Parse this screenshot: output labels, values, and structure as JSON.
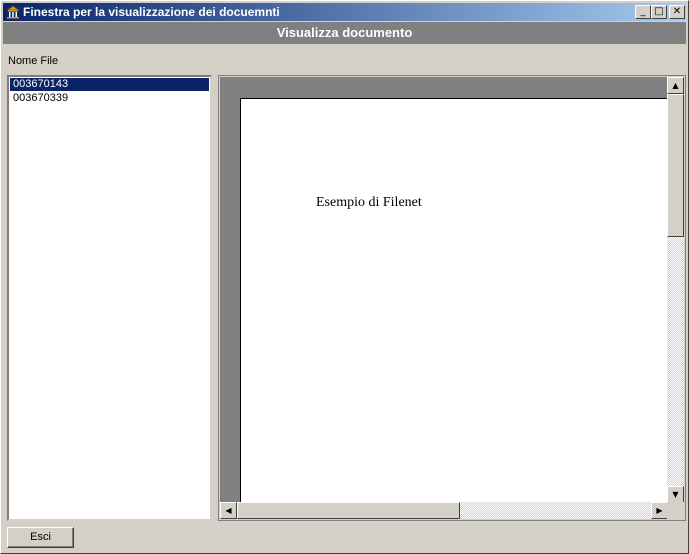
{
  "window": {
    "title": "Finestra per la visualizzazione dei docuemnti",
    "minimize_glyph": "_",
    "maximize_glyph": "□",
    "close_glyph": "✕"
  },
  "banner": {
    "text": "Visualizza documento"
  },
  "filelist": {
    "label": "Nome File",
    "items": [
      "003670143",
      "003670339"
    ],
    "selected_index": 0
  },
  "viewer": {
    "document_text": "Esempio di Filenet",
    "scroll_up_glyph": "▲",
    "scroll_down_glyph": "▼",
    "scroll_left_glyph": "◀",
    "scroll_right_glyph": "▶"
  },
  "footer": {
    "exit_label": "Esci"
  },
  "colors": {
    "titlebar_start": "#0a246a",
    "titlebar_end": "#a6caf0",
    "banner_bg": "#808080",
    "selection_bg": "#0a246a",
    "face": "#d4d0c8"
  }
}
